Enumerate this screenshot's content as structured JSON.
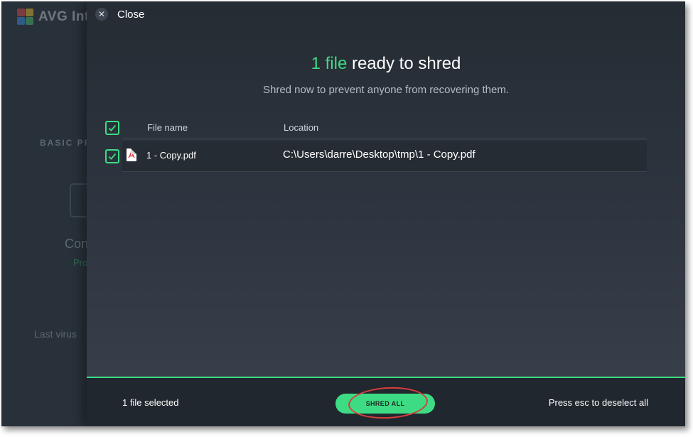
{
  "background_app": {
    "logo_text": "AVG Inte",
    "section_label": "BASIC PR",
    "status_text": "Con",
    "status_sub": "Pro",
    "last_scan_text": "Last virus"
  },
  "dialog": {
    "close_label": "Close",
    "headline_count": "1 file",
    "headline_rest": " ready to shred",
    "subheadline": "Shred now to prevent anyone from recovering them.",
    "columns": {
      "name": "File name",
      "location": "Location"
    },
    "files": [
      {
        "name": "1 - Copy.pdf",
        "location": "C:\\Users\\darre\\Desktop\\tmp\\1 - Copy.pdf",
        "icon": "pdf-file-icon",
        "checked": true
      }
    ],
    "select_all_checked": true
  },
  "footer": {
    "selected_text": "1 file selected",
    "shred_button": "SHRED ALL",
    "esc_hint": "Press esc to deselect all"
  },
  "colors": {
    "accent": "#3ddc84",
    "panel_bg": "#2e3540",
    "annotation": "#d63d3d"
  }
}
